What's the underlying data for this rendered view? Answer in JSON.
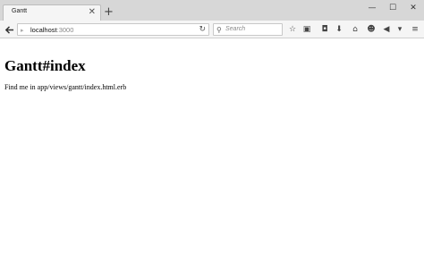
{
  "browser": {
    "tab": {
      "title": "Gantt",
      "close_icon": "close-icon"
    },
    "new_tab_icon": "plus-icon",
    "window_controls": [
      "minimize-icon",
      "maximize-icon",
      "close-icon"
    ],
    "url": {
      "host": "localhost",
      "port": ":3000"
    },
    "search": {
      "placeholder": "Search"
    }
  },
  "page": {
    "title": "Gantt#index",
    "body_text": "Find me in app/views/gantt/index.html.erb"
  }
}
